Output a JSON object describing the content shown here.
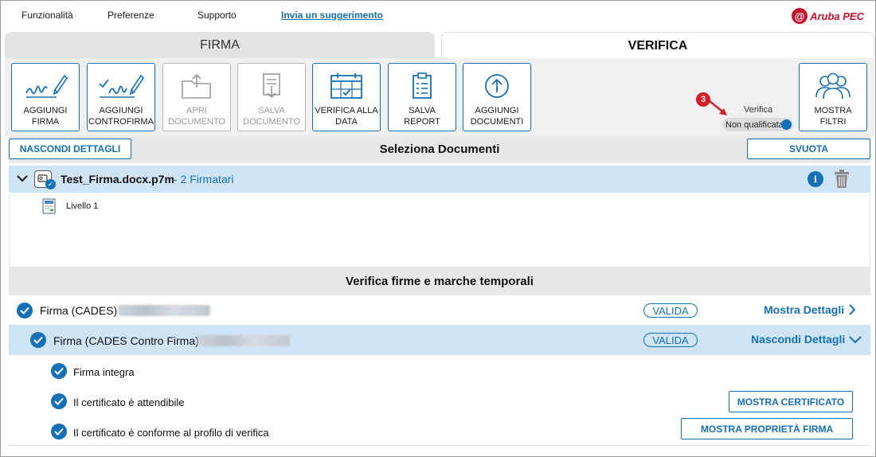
{
  "menu": {
    "items": [
      "Funzionalità",
      "Preferenze",
      "Supporto"
    ],
    "link": "Invia un suggerimento",
    "logo_text": "Aruba PEC"
  },
  "tabs": {
    "firma": "FIRMA",
    "verifica": "VERIFICA"
  },
  "toolbar": [
    {
      "label": "AGGIUNGI\nFIRMA",
      "icon": "signature-pen-icon",
      "enabled": true
    },
    {
      "label": "AGGIUNGI\nCONTROFIRMA",
      "icon": "countersign-pen-icon",
      "enabled": true
    },
    {
      "label": "APRI\nDOCUMENTO",
      "icon": "open-folder-icon",
      "enabled": false
    },
    {
      "label": "SALVA\nDOCUMENTO",
      "icon": "save-document-icon",
      "enabled": false
    },
    {
      "label": "VERIFICA ALLA\nDATA",
      "icon": "calendar-check-icon",
      "enabled": true
    },
    {
      "label": "SALVA\nREPORT",
      "icon": "report-clipboard-icon",
      "enabled": true
    },
    {
      "label": "AGGIUNGI\nDOCUMENTI",
      "icon": "upload-arrow-icon",
      "enabled": true
    }
  ],
  "filters_button": {
    "label": "MOSTRA\nFILTRI",
    "icon": "users-group-icon"
  },
  "verification": {
    "step_badge": "3",
    "label": "Verifica",
    "toggle_text": "Non qualificata"
  },
  "actions": {
    "hide_details": "NASCONDI DETTAGLI",
    "title": "Seleziona Documenti",
    "clear": "SVUOTA"
  },
  "document": {
    "name": "Test_Firma.docx.p7m",
    "signers": "- 2 Firmatari",
    "level": "Livello 1"
  },
  "section_title": "Verifica firme e marche temporali",
  "signatures": [
    {
      "label": "Firma (CADES)",
      "status": "VALIDA",
      "link": "Mostra Dettagli"
    },
    {
      "label": "Firma (CADES Contro Firma)",
      "status": "VALIDA",
      "link": "Nascondi Dettagli"
    }
  ],
  "details": [
    {
      "text": "Firma integra",
      "button": ""
    },
    {
      "text": "Il certificato è attendibile",
      "button": "MOSTRA CERTIFICATO"
    },
    {
      "text": "Il certificato è conforme al profilo di verifica",
      "button": "MOSTRA PROPRIETÀ FIRMA"
    }
  ],
  "colors": {
    "accent": "#1670b7",
    "highlight": "#cfe5f6",
    "brand": "#c8102e",
    "step_badge": "#d31f26"
  }
}
